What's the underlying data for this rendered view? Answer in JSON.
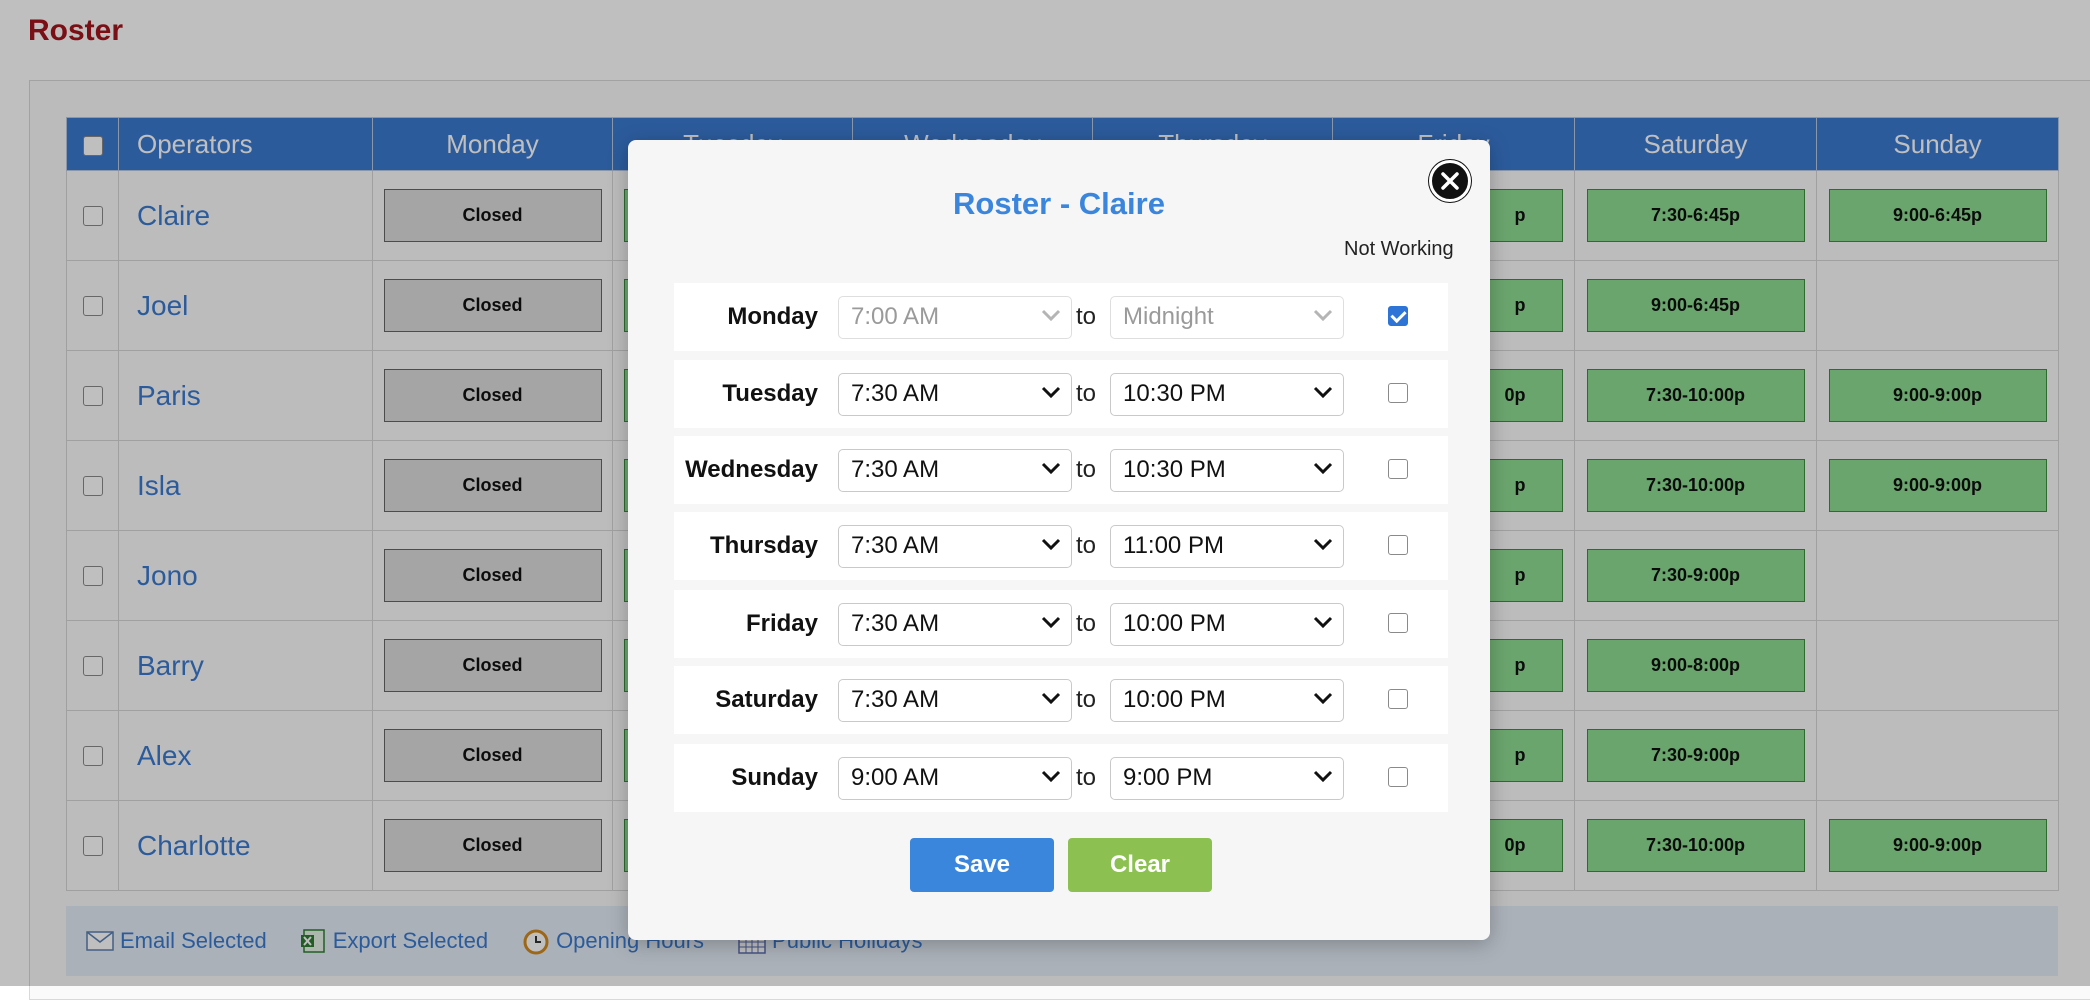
{
  "page": {
    "title": "Roster"
  },
  "table": {
    "headers": [
      "Operators",
      "Monday",
      "Tuesday",
      "Wednesday",
      "Thursday",
      "Friday",
      "Saturday",
      "Sunday"
    ],
    "rows": [
      {
        "name": "Claire",
        "monday": "Closed",
        "friday": "p",
        "saturday": "7:30-6:45p",
        "sunday": "9:00-6:45p"
      },
      {
        "name": "Joel",
        "monday": "Closed",
        "friday": "p",
        "saturday": "9:00-6:45p",
        "sunday": ""
      },
      {
        "name": "Paris",
        "monday": "Closed",
        "friday": "0p",
        "saturday": "7:30-10:00p",
        "sunday": "9:00-9:00p"
      },
      {
        "name": "Isla",
        "monday": "Closed",
        "friday": "p",
        "saturday": "7:30-10:00p",
        "sunday": "9:00-9:00p"
      },
      {
        "name": "Jono",
        "monday": "Closed",
        "friday": "p",
        "saturday": "7:30-9:00p",
        "sunday": ""
      },
      {
        "name": "Barry",
        "monday": "Closed",
        "friday": "p",
        "saturday": "9:00-8:00p",
        "sunday": ""
      },
      {
        "name": "Alex",
        "monday": "Closed",
        "friday": "p",
        "saturday": "7:30-9:00p",
        "sunday": ""
      },
      {
        "name": "Charlotte",
        "monday": "Closed",
        "friday": "0p",
        "saturday": "7:30-10:00p",
        "sunday": "9:00-9:00p"
      }
    ]
  },
  "footer": {
    "email_selected": "Email Selected",
    "export_selected": "Export Selected",
    "opening_hours": "Opening Hours",
    "public_holidays": "Public Holidays"
  },
  "modal": {
    "title": "Roster - Claire",
    "not_working_label": "Not Working",
    "to_label": "to",
    "save_label": "Save",
    "clear_label": "Clear",
    "days": [
      {
        "day": "Monday",
        "start": "7:00 AM",
        "end": "Midnight",
        "not_working": true
      },
      {
        "day": "Tuesday",
        "start": "7:30 AM",
        "end": "10:30 PM",
        "not_working": false
      },
      {
        "day": "Wednesday",
        "start": "7:30 AM",
        "end": "10:30 PM",
        "not_working": false
      },
      {
        "day": "Thursday",
        "start": "7:30 AM",
        "end": "11:00 PM",
        "not_working": false
      },
      {
        "day": "Friday",
        "start": "7:30 AM",
        "end": "10:00 PM",
        "not_working": false
      },
      {
        "day": "Saturday",
        "start": "7:30 AM",
        "end": "10:00 PM",
        "not_working": false
      },
      {
        "day": "Sunday",
        "start": "9:00 AM",
        "end": "9:00 PM",
        "not_working": false
      }
    ]
  },
  "colors": {
    "title_red": "#a3151e",
    "header_blue": "#3b7ad1",
    "shift_green": "#8fdc93",
    "shift_closed": "#dcdcdc",
    "save_blue": "#3b86dd",
    "clear_green": "#8cc151"
  }
}
